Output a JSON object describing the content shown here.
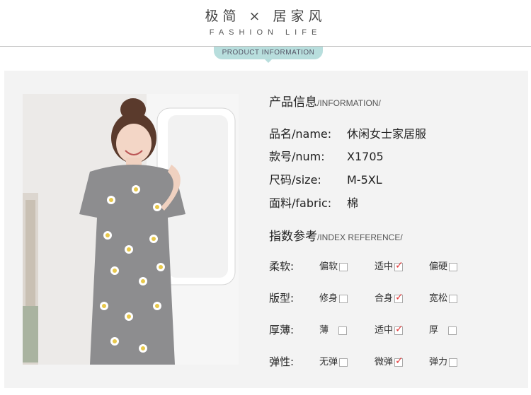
{
  "header": {
    "title": "极简 × 居家风",
    "subtitle": "FASHION LIFE",
    "tag": "PRODUCT INFORMATION"
  },
  "info": {
    "title_cn": "产品信息",
    "title_en": "/INFORMATION/",
    "rows": [
      {
        "label": "品名/name:",
        "value": "休闲女士家居服"
      },
      {
        "label": "款号/num:",
        "value": "X1705"
      },
      {
        "label": "尺码/size:",
        "value": "M-5XL"
      },
      {
        "label": "面料/fabric:",
        "value": "棉"
      }
    ]
  },
  "index": {
    "title_cn": "指数参考",
    "title_en": "/INDEX REFERENCE/",
    "rows": [
      {
        "label": "柔软:",
        "options": [
          {
            "text": "偏软",
            "checked": false
          },
          {
            "text": "适中",
            "checked": true
          },
          {
            "text": "偏硬",
            "checked": false
          }
        ]
      },
      {
        "label": "版型:",
        "options": [
          {
            "text": "修身",
            "checked": false
          },
          {
            "text": "合身",
            "checked": true
          },
          {
            "text": "宽松",
            "checked": false
          }
        ]
      },
      {
        "label": "厚薄:",
        "options": [
          {
            "text": "薄",
            "checked": false
          },
          {
            "text": "适中",
            "checked": true
          },
          {
            "text": "厚",
            "checked": false
          }
        ]
      },
      {
        "label": "弹性:",
        "options": [
          {
            "text": "无弹",
            "checked": false
          },
          {
            "text": "微弹",
            "checked": true
          },
          {
            "text": "弹力",
            "checked": false
          }
        ]
      }
    ]
  },
  "colors": {
    "accent": "#b8dedd",
    "check": "#e23a3a",
    "panel": "#f3f3f3"
  }
}
